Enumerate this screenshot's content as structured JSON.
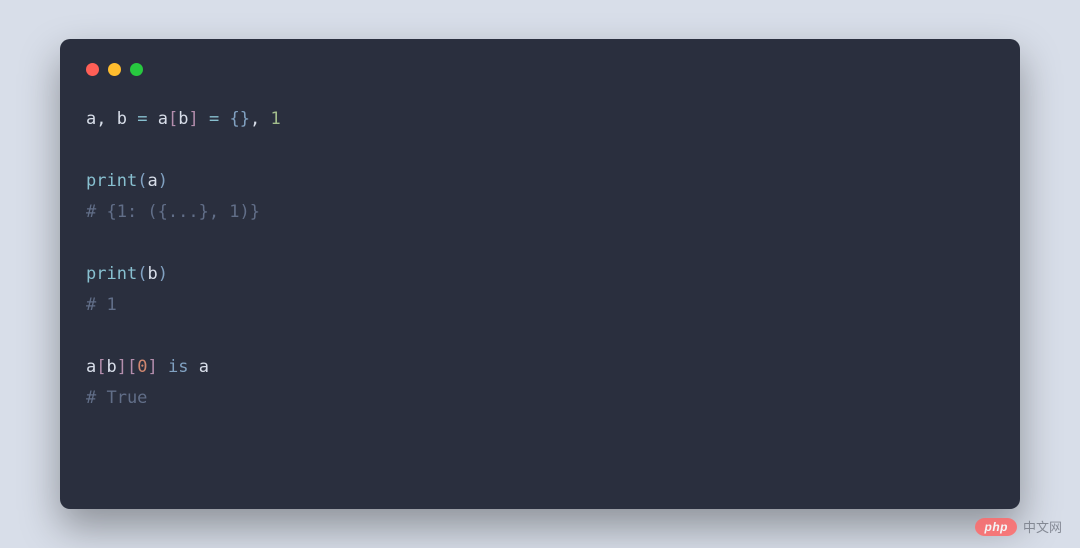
{
  "colors": {
    "bg_outer": "#d8dee9",
    "bg_window": "#2a2f3e",
    "traffic_red": "#ff5f56",
    "traffic_yellow": "#ffbd2e",
    "traffic_green": "#27c93f",
    "token_default": "#d8dee9",
    "token_comment": "#616e88",
    "token_builtin": "#88c0d0",
    "token_keyword": "#81a1c1",
    "token_operator_alt": "#b48ead",
    "token_number_a": "#a3be8c",
    "token_number_b": "#d08770"
  },
  "code_lines": [
    {
      "tokens": [
        {
          "t": "a",
          "c": "w"
        },
        {
          "t": ", ",
          "c": "w"
        },
        {
          "t": "b",
          "c": "w"
        },
        {
          "t": " ",
          "c": "w"
        },
        {
          "t": "=",
          "c": "cy"
        },
        {
          "t": " ",
          "c": "w"
        },
        {
          "t": "a",
          "c": "w"
        },
        {
          "t": "[",
          "c": "pu"
        },
        {
          "t": "b",
          "c": "w"
        },
        {
          "t": "]",
          "c": "pu"
        },
        {
          "t": " ",
          "c": "w"
        },
        {
          "t": "=",
          "c": "cy"
        },
        {
          "t": " ",
          "c": "w"
        },
        {
          "t": "{}",
          "c": "bl"
        },
        {
          "t": ", ",
          "c": "w"
        },
        {
          "t": "1",
          "c": "gr"
        }
      ]
    },
    {
      "tokens": []
    },
    {
      "tokens": [
        {
          "t": "print",
          "c": "cy"
        },
        {
          "t": "(",
          "c": "bl"
        },
        {
          "t": "a",
          "c": "w"
        },
        {
          "t": ")",
          "c": "bl"
        }
      ]
    },
    {
      "tokens": [
        {
          "t": "# {1: ({...}, 1)}",
          "c": "cm"
        }
      ]
    },
    {
      "tokens": []
    },
    {
      "tokens": [
        {
          "t": "print",
          "c": "cy"
        },
        {
          "t": "(",
          "c": "bl"
        },
        {
          "t": "b",
          "c": "w"
        },
        {
          "t": ")",
          "c": "bl"
        }
      ]
    },
    {
      "tokens": [
        {
          "t": "# 1",
          "c": "cm"
        }
      ]
    },
    {
      "tokens": []
    },
    {
      "tokens": [
        {
          "t": "a",
          "c": "w"
        },
        {
          "t": "[",
          "c": "pu"
        },
        {
          "t": "b",
          "c": "w"
        },
        {
          "t": "]",
          "c": "pu"
        },
        {
          "t": "[",
          "c": "pu"
        },
        {
          "t": "0",
          "c": "or"
        },
        {
          "t": "]",
          "c": "pu"
        },
        {
          "t": " ",
          "c": "w"
        },
        {
          "t": "is",
          "c": "bl"
        },
        {
          "t": " ",
          "c": "w"
        },
        {
          "t": "a",
          "c": "w"
        }
      ]
    },
    {
      "tokens": [
        {
          "t": "# True",
          "c": "cm"
        }
      ]
    }
  ],
  "watermark": {
    "badge": "php",
    "text": "中文网"
  }
}
